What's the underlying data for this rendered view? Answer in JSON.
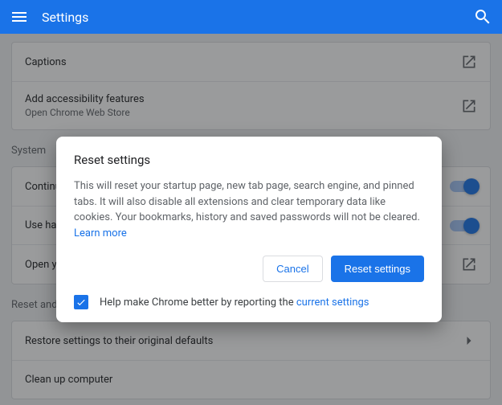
{
  "header": {
    "title": "Settings"
  },
  "rows": {
    "captions": {
      "label": "Captions"
    },
    "a11y": {
      "label": "Add accessibility features",
      "sub": "Open Chrome Web Store"
    },
    "system_label": "System",
    "continue": {
      "label": "Continue"
    },
    "hardware": {
      "label": "Use hard"
    },
    "proxy": {
      "label": "Open yo"
    },
    "reset_label": "Reset and clean up",
    "restore": {
      "label": "Restore settings to their original defaults"
    },
    "cleanup": {
      "label": "Clean up computer"
    }
  },
  "dialog": {
    "title": "Reset settings",
    "body_pre": "This will reset your startup page, new tab page, search engine, and pinned tabs. It will also disable all extensions and clear temporary data like cookies. Your bookmarks, history and saved passwords will not be cleared. ",
    "learn_more": "Learn more",
    "cancel": "Cancel",
    "confirm": "Reset settings",
    "report_pre": "Help make Chrome better by reporting the ",
    "report_link": "current settings"
  }
}
